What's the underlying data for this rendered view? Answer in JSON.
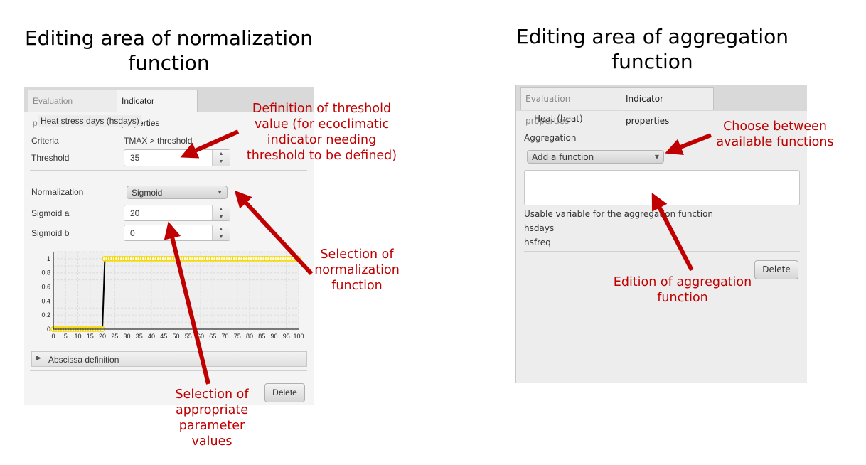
{
  "titles": {
    "left": "Editing area of normalization function",
    "right": "Editing area of aggregation function"
  },
  "left_panel": {
    "tabs": [
      {
        "label": "Evaluation properties",
        "active": false
      },
      {
        "label": "Indicator properties",
        "active": true
      }
    ],
    "indicator_name": "Heat stress days (hsdays)",
    "criteria_label": "Criteria",
    "criteria_value": "TMAX > threshold",
    "threshold_label": "Threshold",
    "threshold_value": "35",
    "normalization_label": "Normalization",
    "normalization_value": "Sigmoid",
    "sigmoid_a_label": "Sigmoid a",
    "sigmoid_a_value": "20",
    "sigmoid_b_label": "Sigmoid b",
    "sigmoid_b_value": "0",
    "abscissa_label": "Abscissa definition",
    "delete_label": "Delete"
  },
  "right_panel": {
    "tabs": [
      {
        "label": "Evaluation properties",
        "active": false
      },
      {
        "label": "Indicator properties",
        "active": true
      }
    ],
    "indicator_name": "Heat (heat)",
    "aggregation_label": "Aggregation",
    "function_combo": "Add a function",
    "function_text": "",
    "usable_label": "Usable variable for the aggregation function",
    "variables": [
      "hsdays",
      "hsfreq"
    ],
    "delete_label": "Delete"
  },
  "annotations": {
    "threshold": "Definition of threshold value (for ecoclimatic indicator needing threshold to be defined)",
    "normalization": "Selection of normalization function",
    "parameters": "Selection of appropriate parameter values",
    "choose": "Choose between available functions",
    "edition": "Edition of aggregation function"
  },
  "colors": {
    "annotation": "#c00000",
    "points": "#f5d800",
    "line": "#000000"
  },
  "chart_data": {
    "type": "line",
    "x_range": [
      0,
      100
    ],
    "y_range": [
      0,
      1.1
    ],
    "xticks": [
      "0",
      "5",
      "10",
      "15",
      "20",
      "25",
      "30",
      "35",
      "40",
      "45",
      "50",
      "55",
      "60",
      "65",
      "70",
      "75",
      "80",
      "85",
      "90",
      "95",
      "100"
    ],
    "yticks": [
      "0",
      "0.2",
      "0.4",
      "0.6",
      "0.8",
      "1"
    ],
    "grid": true,
    "x": [
      0,
      1,
      2,
      3,
      4,
      5,
      6,
      7,
      8,
      9,
      10,
      11,
      12,
      13,
      14,
      15,
      16,
      17,
      18,
      19,
      20,
      21,
      22,
      23,
      24,
      25,
      26,
      27,
      28,
      29,
      30,
      31,
      32,
      33,
      34,
      35,
      36,
      37,
      38,
      39,
      40,
      41,
      42,
      43,
      44,
      45,
      46,
      47,
      48,
      49,
      50,
      51,
      52,
      53,
      54,
      55,
      56,
      57,
      58,
      59,
      60,
      61,
      62,
      63,
      64,
      65,
      66,
      67,
      68,
      69,
      70,
      71,
      72,
      73,
      74,
      75,
      76,
      77,
      78,
      79,
      80,
      81,
      82,
      83,
      84,
      85,
      86,
      87,
      88,
      89,
      90,
      91,
      92,
      93,
      94,
      95,
      96,
      97,
      98,
      99,
      100
    ],
    "y": [
      0,
      0,
      0,
      0,
      0,
      0,
      0,
      0,
      0,
      0,
      0,
      0,
      0,
      0,
      0,
      0,
      0,
      0,
      0,
      0,
      0,
      1,
      1,
      1,
      1,
      1,
      1,
      1,
      1,
      1,
      1,
      1,
      1,
      1,
      1,
      1,
      1,
      1,
      1,
      1,
      1,
      1,
      1,
      1,
      1,
      1,
      1,
      1,
      1,
      1,
      1,
      1,
      1,
      1,
      1,
      1,
      1,
      1,
      1,
      1,
      1,
      1,
      1,
      1,
      1,
      1,
      1,
      1,
      1,
      1,
      1,
      1,
      1,
      1,
      1,
      1,
      1,
      1,
      1,
      1,
      1,
      1,
      1,
      1,
      1,
      1,
      1,
      1,
      1,
      1,
      1,
      1,
      1,
      1,
      1,
      1,
      1,
      1,
      1,
      1,
      1
    ]
  }
}
